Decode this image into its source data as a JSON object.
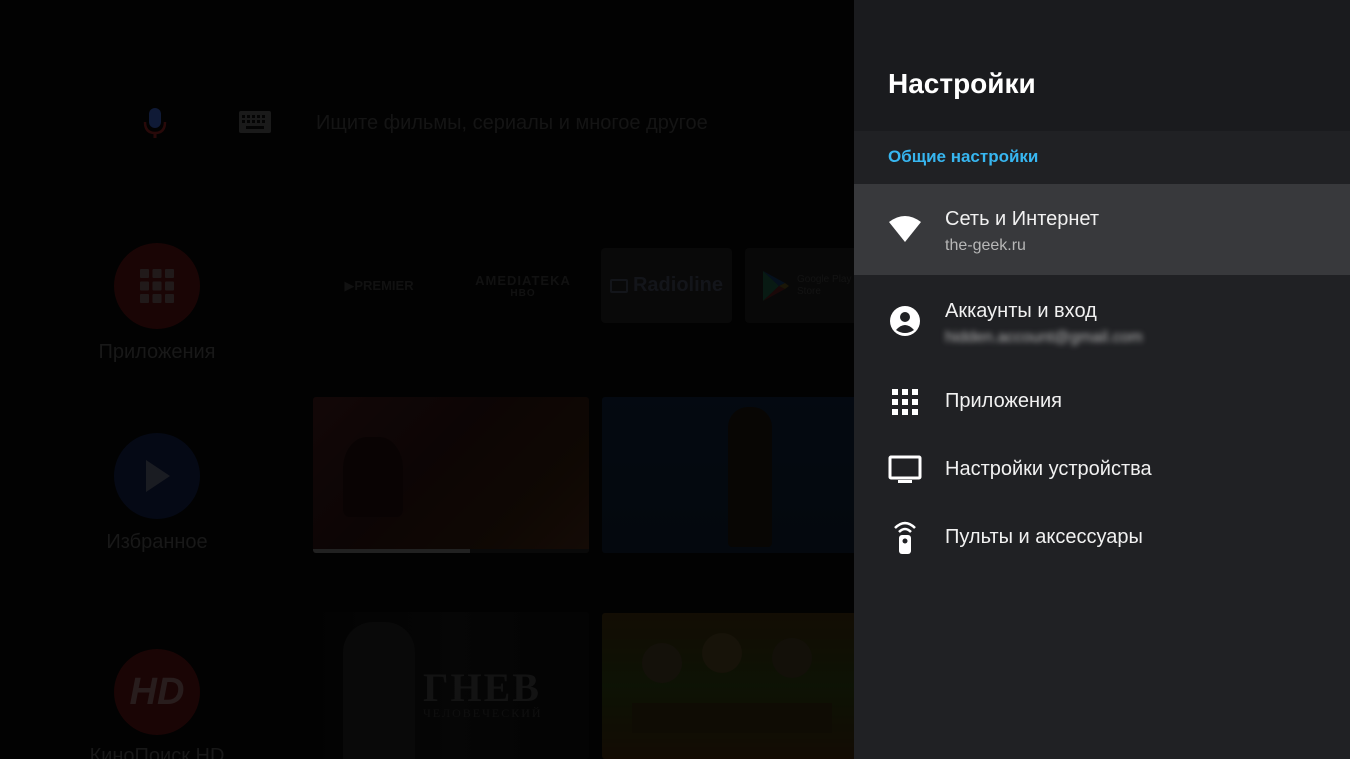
{
  "launcher": {
    "search_placeholder": "Ищите фильмы, сериалы и многое другое",
    "side_apps": [
      {
        "label": "Приложения"
      },
      {
        "label": "Избранное"
      },
      {
        "label": "КиноПоиск HD",
        "logo_text": "HD"
      }
    ],
    "channels": [
      {
        "name": "▶PREMIER"
      },
      {
        "name": "AMEDIATEKA",
        "sub": "HBO"
      },
      {
        "name": "Radioline"
      },
      {
        "name": "Google Play",
        "sub": "Store"
      }
    ],
    "row2_progress": 0.57,
    "row3_title": "ГНЕВ",
    "row3_subtitle": "ЧЕЛОВЕЧЕСКИЙ"
  },
  "settings": {
    "title": "Настройки",
    "section": "Общие настройки",
    "items": [
      {
        "label": "Сеть и Интернет",
        "sub": "the-geek.ru",
        "icon": "wifi-icon",
        "selected": true
      },
      {
        "label": "Аккаунты и вход",
        "sub": "hidden.account@gmail.com",
        "icon": "account-icon",
        "selected": false
      },
      {
        "label": "Приложения",
        "icon": "apps-grid-icon",
        "selected": false
      },
      {
        "label": "Настройки устройства",
        "icon": "tv-icon",
        "selected": false
      },
      {
        "label": "Пульты и аксессуары",
        "icon": "remote-icon",
        "selected": false
      }
    ],
    "accent_color": "#37b6f0"
  }
}
